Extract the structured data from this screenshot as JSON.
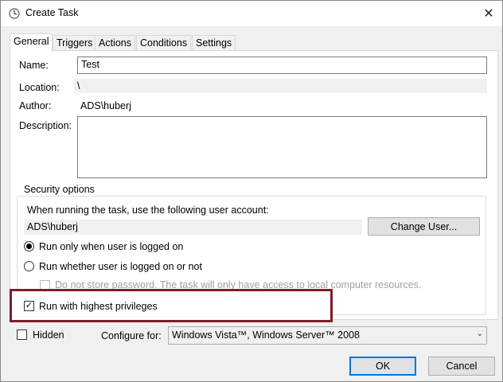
{
  "window": {
    "title": "Create Task",
    "close_glyph": "✕"
  },
  "tabs": [
    {
      "label": "General"
    },
    {
      "label": "Triggers"
    },
    {
      "label": "Actions"
    },
    {
      "label": "Conditions"
    },
    {
      "label": "Settings"
    }
  ],
  "general": {
    "name_label": "Name:",
    "name_value": "Test",
    "location_label": "Location:",
    "location_value": "\\",
    "author_label": "Author:",
    "author_value": "ADS\\huberj",
    "description_label": "Description:",
    "description_value": ""
  },
  "security": {
    "legend": "Security options",
    "account_prompt": "When running the task, use the following user account:",
    "account_value": "ADS\\huberj",
    "change_user_button": "Change User...",
    "radio_logged_on": "Run only when user is logged on",
    "radio_logged_on_checked": true,
    "radio_whether": "Run whether user is logged on or not",
    "radio_whether_checked": false,
    "no_store_password": "Do not store password.  The task will only have access to local computer resources.",
    "no_store_password_enabled": false,
    "highest_privileges": "Run with highest privileges",
    "highest_privileges_checked": true,
    "check_glyph": "✓"
  },
  "footer": {
    "hidden_label": "Hidden",
    "hidden_checked": false,
    "configure_label": "Configure for:",
    "configure_value": "Windows Vista™, Windows Server™ 2008",
    "dropdown_glyph": "⌄",
    "ok_button": "OK",
    "cancel_button": "Cancel"
  },
  "colors": {
    "highlight_border": "#7a1f2b",
    "default_button_border": "#0078d7"
  },
  "icons": {
    "title": "clock-icon",
    "close": "close-icon",
    "dropdown": "chevron-down-icon"
  }
}
